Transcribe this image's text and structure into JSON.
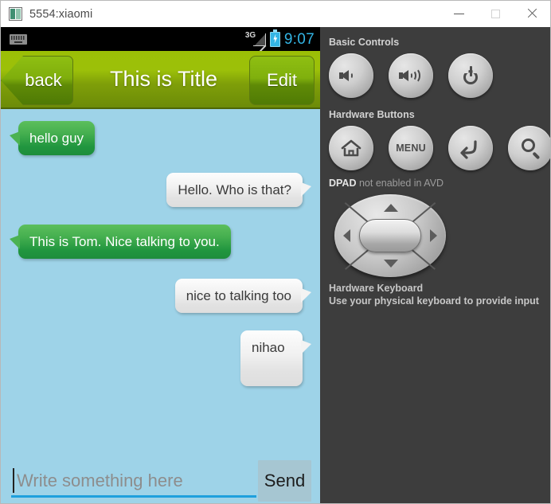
{
  "window": {
    "title": "5554:xiaomi",
    "app_icon": "emulator-icon",
    "minimize_label": "—",
    "maximize_label": "□",
    "close_label": "✕"
  },
  "device": {
    "status_bar": {
      "keyboard_icon": "keyboard-icon",
      "network": "3G",
      "battery_icon": "battery-charging-icon",
      "clock": "9:07"
    },
    "action_bar": {
      "back_label": "back",
      "title": "This is Title",
      "edit_label": "Edit"
    },
    "chat": {
      "messages": [
        {
          "text": "hello guy",
          "side": "left",
          "style": "green"
        },
        {
          "text": "Hello. Who is that?",
          "side": "right",
          "style": "white"
        },
        {
          "text": "This is Tom. Nice talking to you.",
          "side": "left",
          "style": "green"
        },
        {
          "text": "nice to talking too",
          "side": "right",
          "style": "white"
        },
        {
          "text": "nihao",
          "side": "right",
          "style": "white"
        }
      ]
    },
    "input_bar": {
      "placeholder": "Write something here",
      "value": "",
      "send_label": "Send"
    }
  },
  "panel": {
    "basic_controls": {
      "label": "Basic Controls",
      "buttons": [
        {
          "name": "volume-down-icon",
          "label": ""
        },
        {
          "name": "volume-up-icon",
          "label": ""
        },
        {
          "name": "power-icon",
          "label": ""
        }
      ]
    },
    "hardware_buttons": {
      "label": "Hardware Buttons",
      "buttons": [
        {
          "name": "home-icon",
          "label": ""
        },
        {
          "name": "menu-icon",
          "label": "MENU"
        },
        {
          "name": "back-icon",
          "label": ""
        },
        {
          "name": "search-icon",
          "label": ""
        }
      ]
    },
    "dpad": {
      "label_bold": "DPAD",
      "label_dim": " not enabled in AVD"
    },
    "keyboard": {
      "title": "Hardware Keyboard",
      "hint": "Use your physical keyboard to provide input"
    }
  },
  "colors": {
    "chat_background": "#9ed3e8",
    "bubble_green": "#21963f",
    "bubble_white": "#ededed",
    "action_bar_green": "#9bbf06",
    "accent_blue": "#33b5e5",
    "panel_background": "#3d3d3d",
    "send_button": "#a6c6d2"
  }
}
